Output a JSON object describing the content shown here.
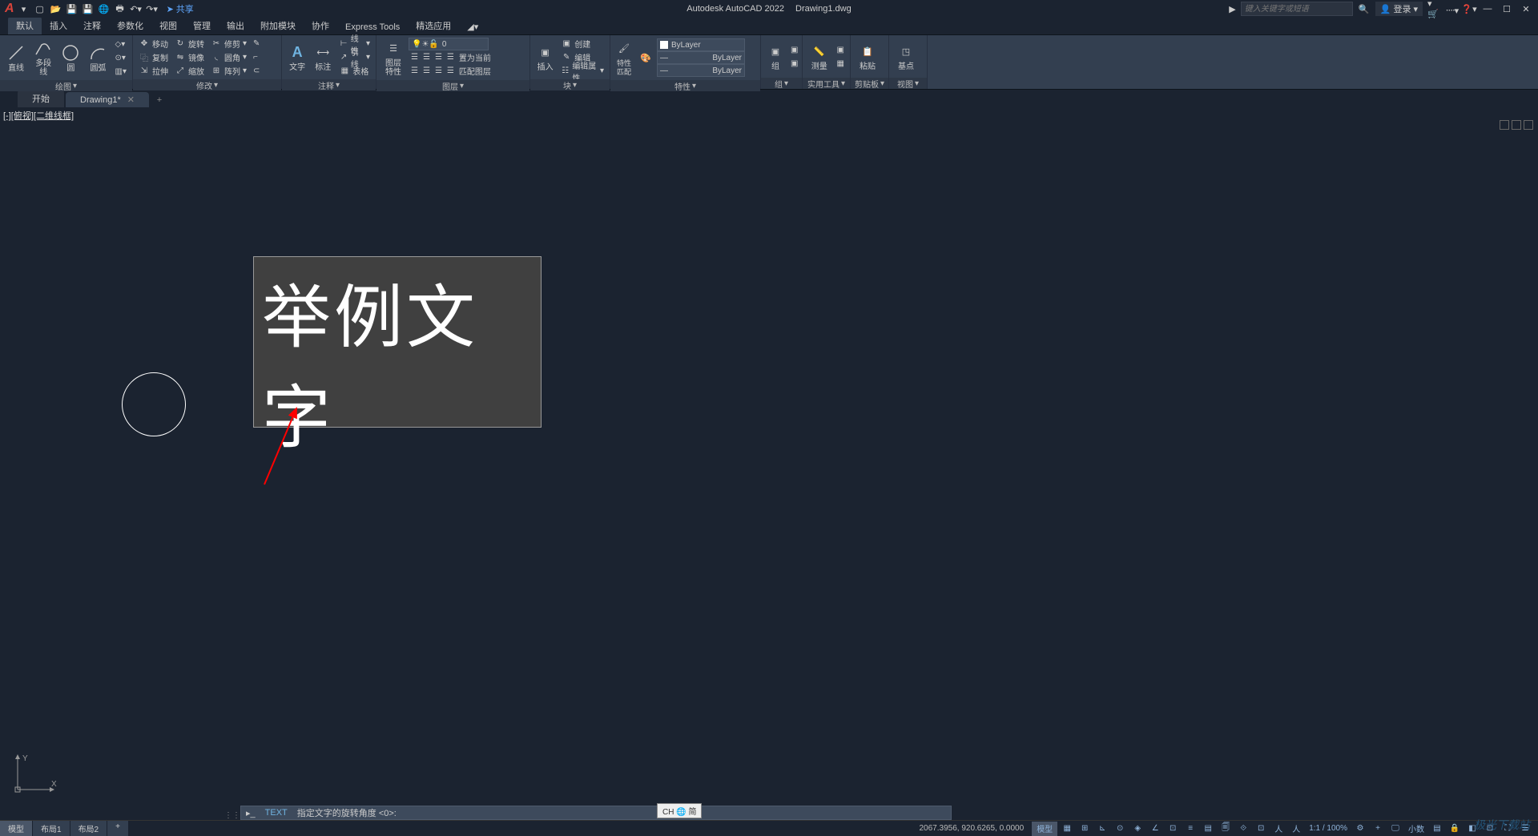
{
  "app": {
    "name": "Autodesk AutoCAD 2022",
    "document": "Drawing1.dwg",
    "share": "共享",
    "search_placeholder": "键入关键字或短语",
    "login": "登录"
  },
  "menu": {
    "items": [
      "默认",
      "插入",
      "注释",
      "参数化",
      "视图",
      "管理",
      "输出",
      "附加模块",
      "协作",
      "Express Tools",
      "精选应用"
    ],
    "active": 0
  },
  "ribbon": {
    "draw": {
      "title": "绘图",
      "line": "直线",
      "polyline": "多段线",
      "circle": "圆",
      "arc": "圆弧"
    },
    "modify": {
      "title": "修改",
      "move": "移动",
      "copy": "复制",
      "stretch": "拉伸",
      "rotate": "旋转",
      "mirror": "镜像",
      "scale": "缩放",
      "trim": "修剪",
      "fillet": "圆角",
      "array": "阵列"
    },
    "annotation": {
      "title": "注释",
      "text": "文字",
      "dim": "标注",
      "linear": "线性",
      "leader": "引线",
      "table": "表格"
    },
    "layers": {
      "title": "图层",
      "props": "图层特性",
      "setcurrent": "置为当前",
      "match": "匹配图层",
      "value": "0"
    },
    "block": {
      "title": "块",
      "insert": "插入",
      "create": "创建",
      "edit": "编辑",
      "attr": "编辑属性"
    },
    "properties": {
      "title": "特性",
      "match": "特性匹配",
      "bylayer": "ByLayer"
    },
    "group": {
      "title": "组",
      "group": "组"
    },
    "utilities": {
      "title": "实用工具",
      "measure": "测量"
    },
    "clipboard": {
      "title": "剪贴板",
      "paste": "粘贴"
    },
    "view": {
      "title": "视图",
      "base": "基点"
    }
  },
  "filetabs": {
    "start": "开始",
    "drawing": "Drawing1*"
  },
  "viewport": {
    "label": "[-][俯视][二维线框]",
    "text_content": "举例文字"
  },
  "cmdline": {
    "prefix": "TEXT",
    "prompt": "指定文字的旋转角度  <0>:"
  },
  "ime": "CH 🌐 简",
  "statusbar": {
    "model": "模型",
    "layout1": "布局1",
    "layout2": "布局2",
    "coords": "2067.3956, 920.6265, 0.0000",
    "scale": "1:1 / 100%",
    "decimal": "小数"
  },
  "watermark": "极光下载站"
}
